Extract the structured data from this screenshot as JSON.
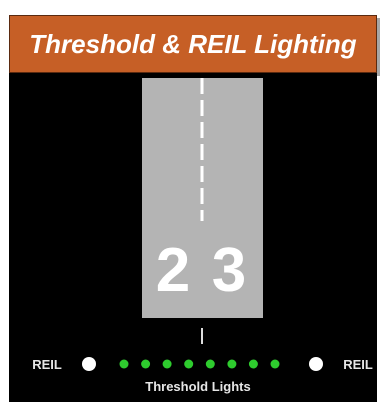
{
  "title": "Threshold & REIL Lighting",
  "runway": {
    "designation_left_digit": "2",
    "designation_right_digit": "3",
    "surface_color": "#b4b4b4",
    "marking_color": "#ffffff"
  },
  "lights": {
    "reil_left_label": "REIL",
    "reil_right_label": "REIL",
    "threshold_label": "Threshold Lights",
    "threshold_light_count": 8,
    "threshold_color": "#2ecc2e",
    "reil_color": "#ffffff"
  },
  "colors": {
    "title_bg": "#c65f26",
    "title_text": "#ffffff",
    "background": "#000000"
  }
}
